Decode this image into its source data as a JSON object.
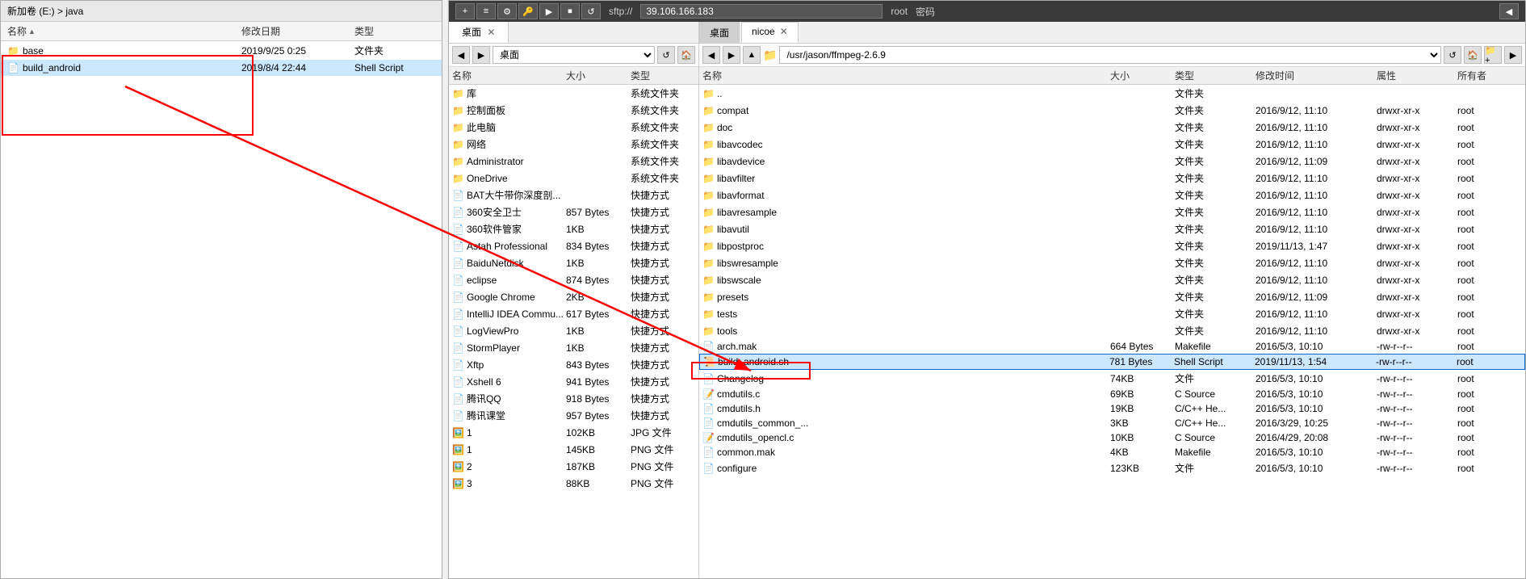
{
  "leftPanel": {
    "title": "新加卷 (E:) > java",
    "columns": {
      "name": "名称",
      "date": "修改日期",
      "type": "类型"
    },
    "files": [
      {
        "name": "base",
        "date": "2019/9/25 0:25",
        "type": "文件夹",
        "icon": "folder"
      },
      {
        "name": "build_android",
        "date": "2019/8/4 22:44",
        "type": "Shell Script",
        "icon": "script"
      }
    ]
  },
  "sftpPanel": {
    "topBar": {
      "host": "sftp://39.106.166.183",
      "userLabel": "root",
      "passwordLabel": "密码"
    },
    "localPane": {
      "tab": "桌面",
      "path": "桌面",
      "columns": {
        "name": "名称",
        "size": "大小",
        "type": "类型"
      },
      "files": [
        {
          "name": "库",
          "size": "",
          "type": "系统文件夹",
          "icon": "folder"
        },
        {
          "name": "控制面板",
          "size": "",
          "type": "系统文件夹",
          "icon": "folder"
        },
        {
          "name": "此电脑",
          "size": "",
          "type": "系统文件夹",
          "icon": "folder"
        },
        {
          "name": "网络",
          "size": "",
          "type": "系统文件夹",
          "icon": "folder"
        },
        {
          "name": "Administrator",
          "size": "",
          "type": "系统文件夹",
          "icon": "folder"
        },
        {
          "name": "OneDrive",
          "size": "",
          "type": "系统文件夹",
          "icon": "folder"
        },
        {
          "name": "BAT大牛带你深度剖...",
          "size": "",
          "type": "快捷方式",
          "icon": "file"
        },
        {
          "name": "360安全卫士",
          "size": "857 Bytes",
          "type": "快捷方式",
          "icon": "file"
        },
        {
          "name": "360软件管家",
          "size": "1KB",
          "type": "快捷方式",
          "icon": "file"
        },
        {
          "name": "Astah Professional",
          "size": "834 Bytes",
          "type": "快捷方式",
          "icon": "file"
        },
        {
          "name": "BaiduNetdisk",
          "size": "1KB",
          "type": "快捷方式",
          "icon": "file"
        },
        {
          "name": "eclipse",
          "size": "874 Bytes",
          "type": "快捷方式",
          "icon": "file"
        },
        {
          "name": "Google Chrome",
          "size": "2KB",
          "type": "快捷方式",
          "icon": "file"
        },
        {
          "name": "IntelliJ IDEA Commu...",
          "size": "617 Bytes",
          "type": "快捷方式",
          "icon": "file"
        },
        {
          "name": "LogViewPro",
          "size": "1KB",
          "type": "快捷方式",
          "icon": "file"
        },
        {
          "name": "StormPlayer",
          "size": "1KB",
          "type": "快捷方式",
          "icon": "file"
        },
        {
          "name": "Xftp",
          "size": "843 Bytes",
          "type": "快捷方式",
          "icon": "file"
        },
        {
          "name": "Xshell 6",
          "size": "941 Bytes",
          "type": "快捷方式",
          "icon": "file"
        },
        {
          "name": "腾讯QQ",
          "size": "918 Bytes",
          "type": "快捷方式",
          "icon": "file"
        },
        {
          "name": "腾讯课堂",
          "size": "957 Bytes",
          "type": "快捷方式",
          "icon": "file"
        },
        {
          "name": "1",
          "size": "102KB",
          "type": "JPG 文件",
          "icon": "img"
        },
        {
          "name": "1",
          "size": "145KB",
          "type": "PNG 文件",
          "icon": "img"
        },
        {
          "name": "2",
          "size": "187KB",
          "type": "PNG 文件",
          "icon": "img"
        },
        {
          "name": "3",
          "size": "88KB",
          "type": "PNG 文件",
          "icon": "img"
        }
      ]
    },
    "remotePane": {
      "tabs": [
        {
          "label": "桌面",
          "active": false,
          "closeable": false
        },
        {
          "label": "nicoe",
          "active": true,
          "closeable": true
        }
      ],
      "path": "/usr/jason/ffmpeg-2.6.9",
      "columns": {
        "name": "名称",
        "size": "大小",
        "type": "类型",
        "modified": "修改时间",
        "attrs": "属性",
        "owner": "所有者"
      },
      "files": [
        {
          "name": "..",
          "size": "",
          "type": "文件夹",
          "modified": "",
          "attrs": "",
          "owner": ""
        },
        {
          "name": "compat",
          "size": "",
          "type": "文件夹",
          "modified": "2016/9/12, 11:10",
          "attrs": "drwxr-xr-x",
          "owner": "root"
        },
        {
          "name": "doc",
          "size": "",
          "type": "文件夹",
          "modified": "2016/9/12, 11:10",
          "attrs": "drwxr-xr-x",
          "owner": "root"
        },
        {
          "name": "libavcodec",
          "size": "",
          "type": "文件夹",
          "modified": "2016/9/12, 11:10",
          "attrs": "drwxr-xr-x",
          "owner": "root"
        },
        {
          "name": "libavdevice",
          "size": "",
          "type": "文件夹",
          "modified": "2016/9/12, 11:09",
          "attrs": "drwxr-xr-x",
          "owner": "root"
        },
        {
          "name": "libavfilter",
          "size": "",
          "type": "文件夹",
          "modified": "2016/9/12, 11:10",
          "attrs": "drwxr-xr-x",
          "owner": "root"
        },
        {
          "name": "libavformat",
          "size": "",
          "type": "文件夹",
          "modified": "2016/9/12, 11:10",
          "attrs": "drwxr-xr-x",
          "owner": "root"
        },
        {
          "name": "libavresample",
          "size": "",
          "type": "文件夹",
          "modified": "2016/9/12, 11:10",
          "attrs": "drwxr-xr-x",
          "owner": "root"
        },
        {
          "name": "libavutil",
          "size": "",
          "type": "文件夹",
          "modified": "2016/9/12, 11:10",
          "attrs": "drwxr-xr-x",
          "owner": "root"
        },
        {
          "name": "libpostproc",
          "size": "",
          "type": "文件夹",
          "modified": "2019/11/13, 1:47",
          "attrs": "drwxr-xr-x",
          "owner": "root"
        },
        {
          "name": "libswresample",
          "size": "",
          "type": "文件夹",
          "modified": "2016/9/12, 11:10",
          "attrs": "drwxr-xr-x",
          "owner": "root"
        },
        {
          "name": "libswscale",
          "size": "",
          "type": "文件夹",
          "modified": "2016/9/12, 11:10",
          "attrs": "drwxr-xr-x",
          "owner": "root"
        },
        {
          "name": "presets",
          "size": "",
          "type": "文件夹",
          "modified": "2016/9/12, 11:09",
          "attrs": "drwxr-xr-x",
          "owner": "root"
        },
        {
          "name": "tests",
          "size": "",
          "type": "文件夹",
          "modified": "2016/9/12, 11:10",
          "attrs": "drwxr-xr-x",
          "owner": "root"
        },
        {
          "name": "tools",
          "size": "",
          "type": "文件夹",
          "modified": "2016/9/12, 11:10",
          "attrs": "drwxr-xr-x",
          "owner": "root"
        },
        {
          "name": "arch.mak",
          "size": "664 Bytes",
          "type": "Makefile",
          "modified": "2016/5/3, 10:10",
          "attrs": "-rw-r--r--",
          "owner": "root"
        },
        {
          "name": "build_android.sh",
          "size": "781 Bytes",
          "type": "Shell Script",
          "modified": "2019/11/13, 1:54",
          "attrs": "-rw-r--r--",
          "owner": "root",
          "highlighted": true
        },
        {
          "name": "Changelog",
          "size": "74KB",
          "type": "文件",
          "modified": "2016/5/3, 10:10",
          "attrs": "-rw-r--r--",
          "owner": "root"
        },
        {
          "name": "cmdutils.c",
          "size": "69KB",
          "type": "C Source",
          "modified": "2016/5/3, 10:10",
          "attrs": "-rw-r--r--",
          "owner": "root"
        },
        {
          "name": "cmdutils.h",
          "size": "19KB",
          "type": "C/C++ He...",
          "modified": "2016/5/3, 10:10",
          "attrs": "-rw-r--r--",
          "owner": "root"
        },
        {
          "name": "cmdutils_common_...",
          "size": "3KB",
          "type": "C/C++ He...",
          "modified": "2016/3/29, 10:25",
          "attrs": "-rw-r--r--",
          "owner": "root"
        },
        {
          "name": "cmdutils_opencl.c",
          "size": "10KB",
          "type": "C Source",
          "modified": "2016/4/29, 20:08",
          "attrs": "-rw-r--r--",
          "owner": "root"
        },
        {
          "name": "common.mak",
          "size": "4KB",
          "type": "Makefile",
          "modified": "2016/5/3, 10:10",
          "attrs": "-rw-r--r--",
          "owner": "root"
        },
        {
          "name": "configure",
          "size": "123KB",
          "type": "文件",
          "modified": "2016/5/3, 10:10",
          "attrs": "-rw-r--r--",
          "owner": "root"
        }
      ]
    }
  },
  "annotations": {
    "redBox1Label": "build_android highlighted in left panel",
    "redBox2Label": "build_android.sh highlighted in remote panel",
    "arrowLabel": "connection arrow"
  }
}
